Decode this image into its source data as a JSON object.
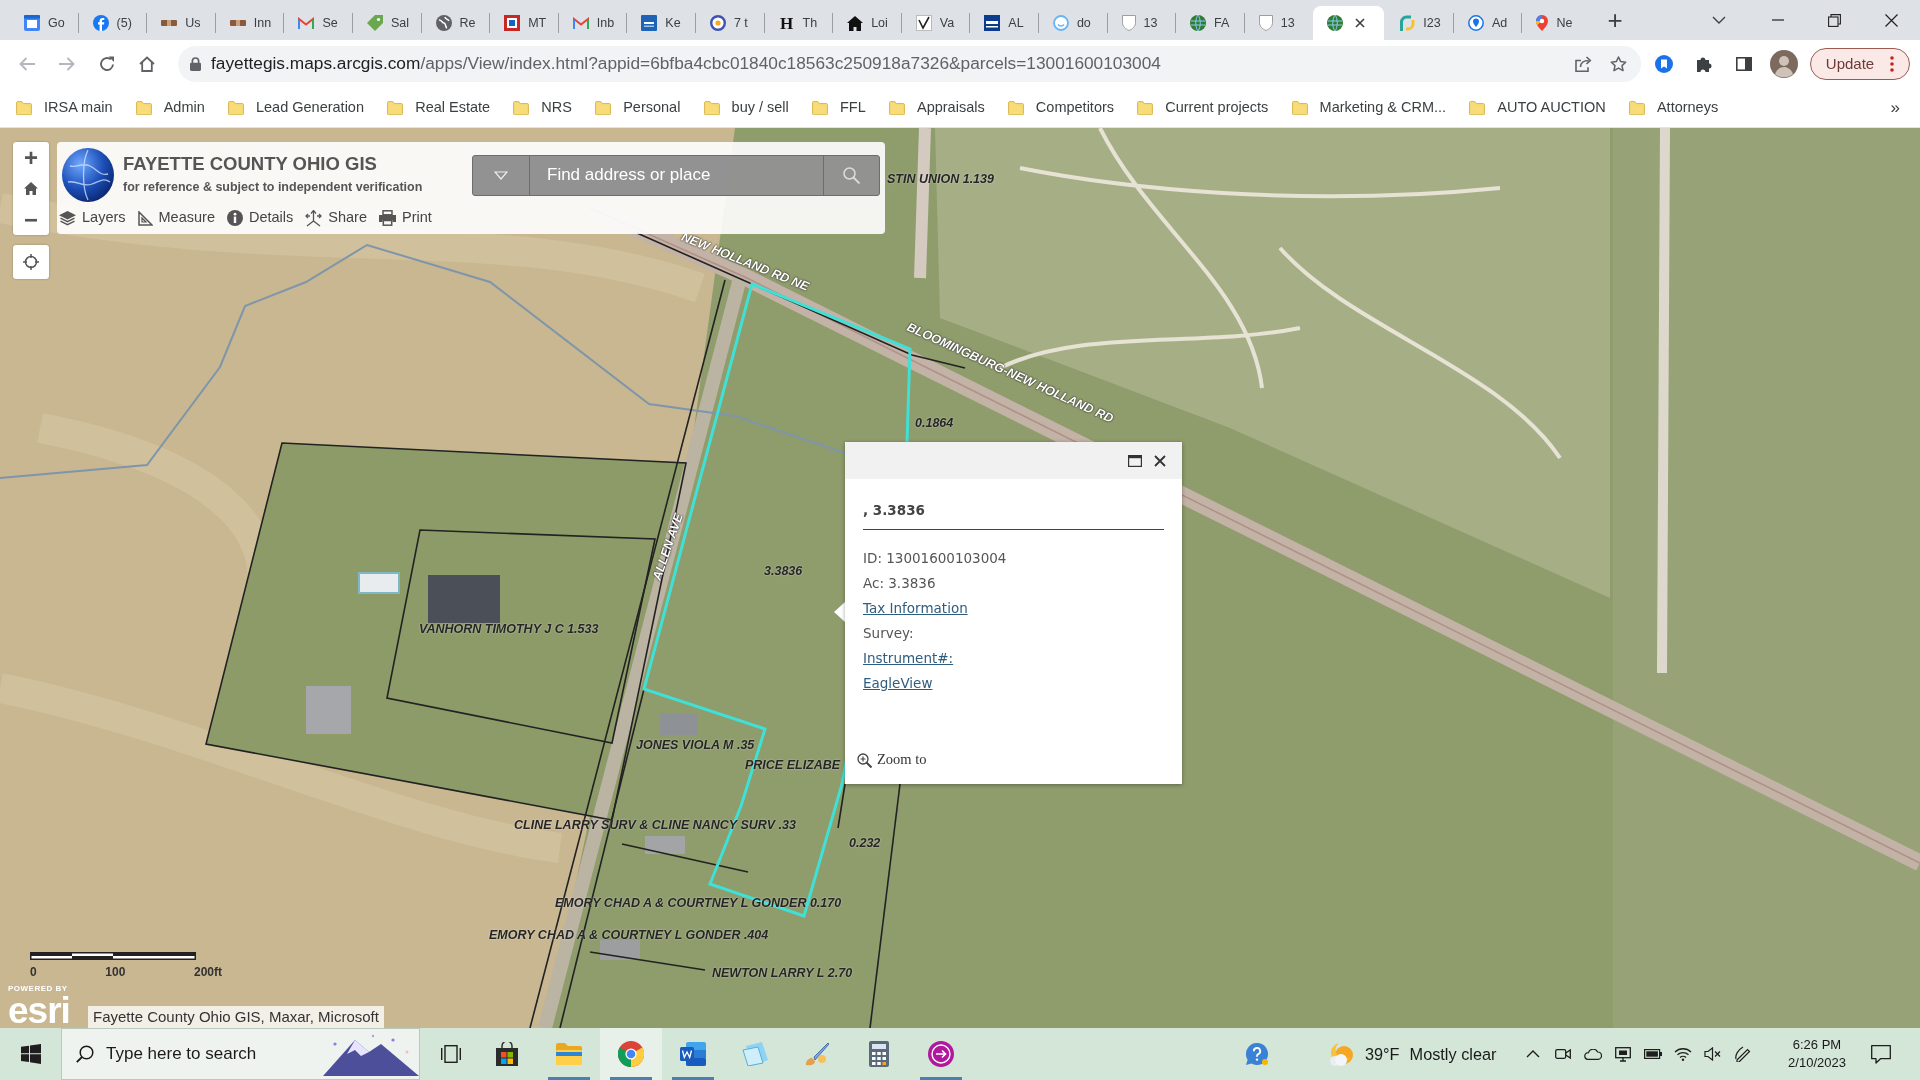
{
  "browser": {
    "tabs": [
      {
        "label": "Go",
        "selected": false
      },
      {
        "label": "(5)",
        "selected": false
      },
      {
        "label": "Us",
        "selected": false
      },
      {
        "label": "Inn",
        "selected": false
      },
      {
        "label": "Se",
        "selected": false
      },
      {
        "label": "Sal",
        "selected": false
      },
      {
        "label": "Re",
        "selected": false
      },
      {
        "label": "MT",
        "selected": false
      },
      {
        "label": "Inb",
        "selected": false
      },
      {
        "label": "Ke",
        "selected": false
      },
      {
        "label": "7 t",
        "selected": false
      },
      {
        "label": "Th",
        "icon_text": "H",
        "selected": false
      },
      {
        "label": "Loi",
        "selected": false
      },
      {
        "label": "Va",
        "selected": false
      },
      {
        "label": "AL",
        "selected": false
      },
      {
        "label": "do",
        "selected": false
      },
      {
        "label": "13",
        "selected": false
      },
      {
        "label": "FA",
        "selected": false
      },
      {
        "label": "13",
        "selected": false
      },
      {
        "selected": true
      },
      {
        "label": "I23",
        "selected": false
      },
      {
        "label": "Ad",
        "selected": false
      },
      {
        "label": "Ne",
        "selected": false
      }
    ],
    "new_tab": "+",
    "address": {
      "host": "fayettegis.maps.arcgis.com",
      "path": "/apps/View/index.html?appid=6bfba4cbc01840c18563c250918a7326&parcels=13001600103004"
    },
    "update_button": "Update",
    "bookmarks": [
      "IRSA main",
      "Admin",
      "Lead Generation",
      "Real Estate",
      "NRS",
      "Personal",
      "buy / sell",
      "FFL",
      "Appraisals",
      "Competitors",
      "Current projects",
      "Marketing & CRM...",
      "AUTO AUCTION",
      "Attorneys"
    ],
    "bookmarks_overflow": "»"
  },
  "map": {
    "zoom_in": "+",
    "zoom_out": "−",
    "header": {
      "title": "FAYETTE COUNTY OHIO GIS",
      "subtitle": "for reference & subject to independent verification",
      "search": {
        "placeholder": "Find address or place"
      },
      "tools": [
        "Layers",
        "Measure",
        "Details",
        "Share",
        "Print"
      ]
    },
    "labels": [
      {
        "kind": "parcel",
        "text": "STIN UNION 1.139"
      },
      {
        "kind": "road",
        "text": "NEW HOLLAND RD NE"
      },
      {
        "kind": "road",
        "text": "BLOOMINGBURG-NEW HOLLAND RD"
      },
      {
        "kind": "parcel",
        "text": "0.1864"
      },
      {
        "kind": "road",
        "text": "ALLEN AVE"
      },
      {
        "kind": "parcel",
        "text": "3.3836"
      },
      {
        "kind": "parcel",
        "text": "VANHORN TIMOTHY J C 1.533"
      },
      {
        "kind": "parcel",
        "text": "JONES VIOLA M .35"
      },
      {
        "kind": "parcel",
        "text": "PRICE ELIZABE"
      },
      {
        "kind": "parcel",
        "text": "CLINE LARRY SURV & CLINE NANCY SURV .33"
      },
      {
        "kind": "parcel",
        "text": "0.232"
      },
      {
        "kind": "parcel",
        "text": "EMORY CHAD A & COURTNEY L GONDER 0.170"
      },
      {
        "kind": "parcel",
        "text": "EMORY CHAD A & COURTNEY L GONDER .404"
      },
      {
        "kind": "parcel",
        "text": "NEWTON LARRY L 2.70"
      }
    ],
    "popup": {
      "title": ", 3.3836",
      "fields": [
        {
          "kind": "text",
          "text": "ID: 13001600103004"
        },
        {
          "kind": "text",
          "text": "Ac: 3.3836"
        },
        {
          "kind": "link",
          "text": "Tax Information"
        },
        {
          "kind": "text",
          "text": "Survey:"
        },
        {
          "kind": "link",
          "text": "Instrument#:"
        },
        {
          "kind": "link",
          "text": "EagleView"
        }
      ],
      "zoom_to": "Zoom to"
    },
    "scale_bar": [
      "0",
      "100",
      "200ft"
    ],
    "logo": {
      "caption": "POWERED BY",
      "name": "esri"
    },
    "attribution": "Fayette County Ohio GIS, Maxar, Microsoft"
  },
  "taskbar": {
    "search": {
      "placeholder": "Type here to search"
    },
    "apps": [
      {
        "open": false,
        "selected": false
      },
      {
        "open": true,
        "selected": false
      },
      {
        "open": true,
        "selected": true
      },
      {
        "open": true,
        "selected": false
      },
      {
        "open": false,
        "selected": false
      },
      {
        "open": false,
        "selected": false
      },
      {
        "open": false,
        "selected": false
      },
      {
        "open": true,
        "selected": false
      }
    ],
    "weather": {
      "temperature": "39°F",
      "condition": "Mostly clear"
    },
    "clock": {
      "time": "6:26 PM",
      "date": "2/10/2023"
    }
  }
}
